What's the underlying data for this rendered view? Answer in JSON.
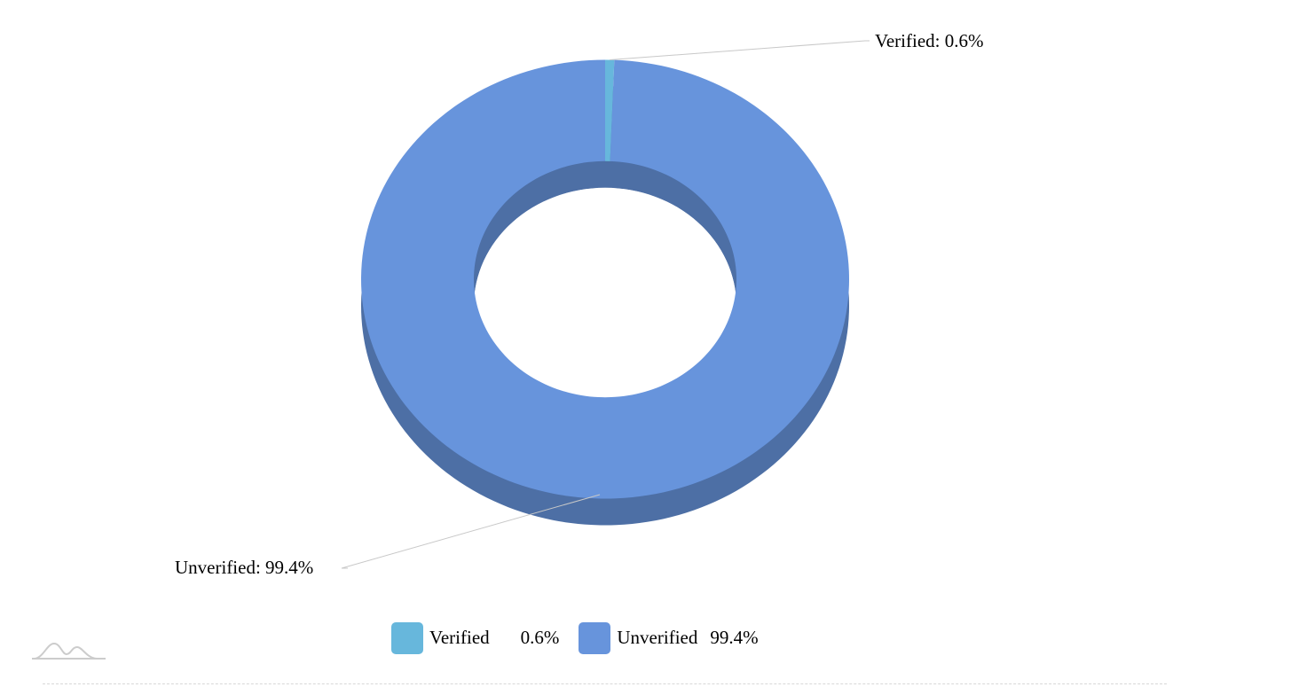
{
  "chart_data": {
    "type": "pie",
    "variant": "donut-3d",
    "categories": [
      "Verified",
      "Unverified"
    ],
    "values": [
      0.6,
      99.4
    ],
    "colors": [
      "#67b7dc",
      "#6794dc"
    ],
    "slice_labels": [
      "Verified: 0.6%",
      "Unverified: 99.4%"
    ],
    "legend": {
      "placement": "bottom",
      "items": [
        {
          "name": "Verified",
          "value": "0.6%",
          "color": "#67b7dc"
        },
        {
          "name": "Unverified",
          "value": "99.4%",
          "color": "#6794dc"
        }
      ]
    }
  },
  "logo": {
    "icon": "amcharts-logo-icon"
  }
}
